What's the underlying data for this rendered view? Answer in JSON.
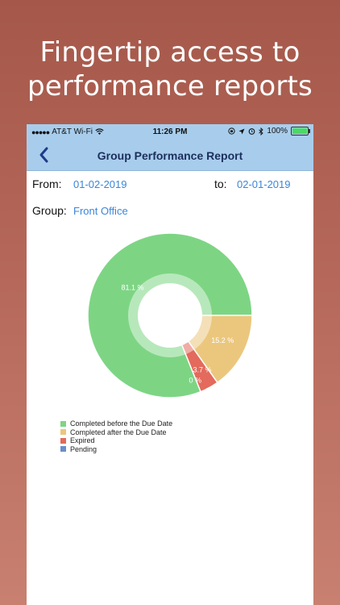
{
  "headline": [
    "Fingertip access to",
    "performance reports"
  ],
  "status_bar": {
    "carrier": "AT&T Wi-Fi",
    "time": "11:26 PM",
    "battery": "100%"
  },
  "nav": {
    "title": "Group Performance Report"
  },
  "filters": {
    "from_label": "From:",
    "from_value": "01-02-2019",
    "to_label": "to:",
    "to_value": "02-01-2019",
    "group_label": "Group:",
    "group_value": "Front Office"
  },
  "colors": {
    "completed_before": "#7dd584",
    "completed_after": "#ebc77e",
    "expired": "#e36a5c",
    "pending": "#6a8fc8"
  },
  "chart_data": {
    "type": "pie",
    "donut": true,
    "series": [
      {
        "name": "Completed before the Due Date",
        "value": 81.1,
        "label": "81.1 %"
      },
      {
        "name": "Completed after the Due Date",
        "value": 15.2,
        "label": "15.2 %"
      },
      {
        "name": "Expired",
        "value": 3.7,
        "label": "3.7 %"
      },
      {
        "name": "Pending",
        "value": 0,
        "label": "0 %"
      }
    ],
    "legend_position": "bottom-left"
  }
}
